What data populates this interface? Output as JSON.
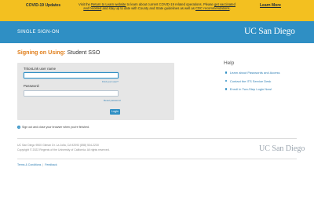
{
  "covid": {
    "title": "COVID-19 Updates",
    "msg_prefix": "Visit the ",
    "link1": "Return to Learn website",
    "msg_mid": " to learn about current COVID-19 related operations. Please ",
    "link2": "get vaccinated and boosted",
    "msg_mid2": " and stay up to date with County and State guidelines as well as ",
    "link3": "CDC recommendations",
    "msg_end": ".",
    "learn_more": "Learn More"
  },
  "header": {
    "title": "SINGLE SIGN-ON",
    "logo": "UC San Diego"
  },
  "signing": {
    "label": "Signing on Using:",
    "app": "Student SSO"
  },
  "login": {
    "username_label": "TritonLink user name",
    "username_value": "",
    "forgot_username": "Find your user?",
    "password_label": "Password:",
    "password_value": "",
    "forgot_password": "Reset password",
    "button": "Login"
  },
  "signout_note": "Sign out and close your browser when you're finished.",
  "help": {
    "title": "Help",
    "items": [
      {
        "label": "Learn about Passwords and Access"
      },
      {
        "label": "Contact the ITS Service Desk"
      },
      {
        "label": "Enroll in Two-Step Login Now!"
      }
    ]
  },
  "footer": {
    "address": "UC San Diego 9500 Gilman Dr. La Jolla, CA 92093 (858) 534-2230",
    "copyright": "Copyright © 2022 Regents of the University of California. All rights reserved.",
    "logo": "UC San Diego",
    "links": [
      "Terms & Conditions",
      "Feedback"
    ],
    "separator": "|"
  },
  "colors": {
    "banner": "#f3c020",
    "header": "#2f8fc4",
    "accent_orange": "#e07e1a",
    "link_blue": "#2f7fb4",
    "card_bg": "#e6e6e6"
  }
}
